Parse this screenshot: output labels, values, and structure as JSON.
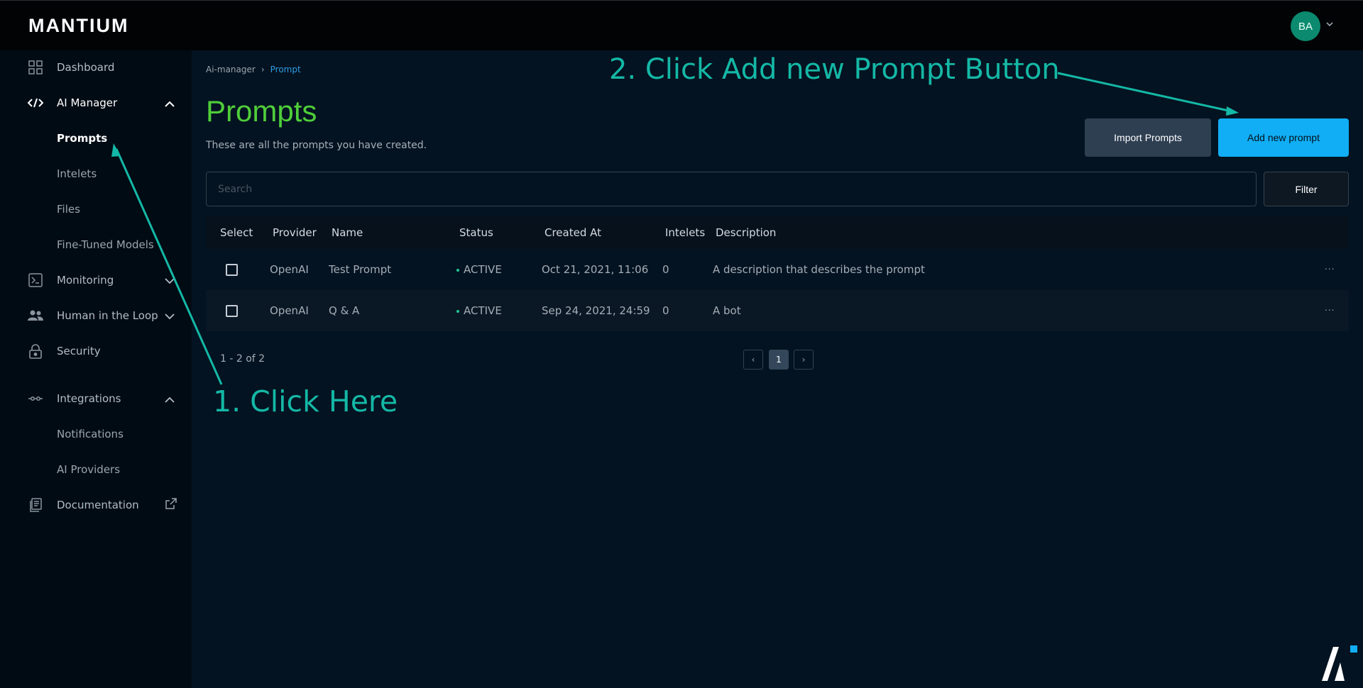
{
  "app": {
    "logo": "MANTIUM"
  },
  "user": {
    "initials": "BA"
  },
  "sidebar": {
    "items": [
      {
        "label": "Dashboard",
        "icon": "grid-icon"
      },
      {
        "label": "AI Manager",
        "icon": "code-icon"
      },
      {
        "label": "Prompts"
      },
      {
        "label": "Intelets"
      },
      {
        "label": "Files"
      },
      {
        "label": "Fine-Tuned Models"
      },
      {
        "label": "Monitoring",
        "icon": "terminal-icon"
      },
      {
        "label": "Human in the Loop",
        "icon": "people-icon"
      },
      {
        "label": "Security",
        "icon": "lock-icon"
      },
      {
        "label": "Integrations",
        "icon": "link-icon"
      },
      {
        "label": "Notifications"
      },
      {
        "label": "AI Providers"
      },
      {
        "label": "Documentation",
        "icon": "document-icon"
      }
    ]
  },
  "breadcrumb": {
    "parent": "Ai-manager",
    "separator": "›",
    "current": "Prompt"
  },
  "page": {
    "title": "Prompts",
    "subtitle": "These are all the prompts you have created."
  },
  "buttons": {
    "import": "Import Prompts",
    "add": "Add new prompt",
    "filter": "Filter"
  },
  "search": {
    "placeholder": "Search",
    "value": ""
  },
  "table": {
    "headers": [
      "Select",
      "Provider",
      "Name",
      "Status",
      "Created At",
      "Intelets",
      "Description"
    ],
    "rows": [
      {
        "provider": "OpenAI",
        "name": "Test Prompt",
        "status": "ACTIVE",
        "created_at": "Oct 21, 2021, 11:06",
        "intelets": "0",
        "description": "A description that describes the prompt",
        "menu": "..."
      },
      {
        "provider": "OpenAI",
        "name": "Q & A",
        "status": "ACTIVE",
        "created_at": "Sep 24, 2021, 24:59",
        "intelets": "0",
        "description": "A bot",
        "menu": "..."
      }
    ]
  },
  "pagination": {
    "summary": "1 - 2 of 2",
    "prev": "‹",
    "current_page": "1",
    "next": "›"
  },
  "annotations": {
    "step1": "1. Click Here",
    "step2": "2. Click Add new Prompt Button"
  },
  "colors": {
    "title_green": "#4fce3a",
    "accent_blue": "#11aef5",
    "annotation_teal": "#14b8a6",
    "status_active": "#20c997",
    "avatar": "#0b8a6f"
  }
}
